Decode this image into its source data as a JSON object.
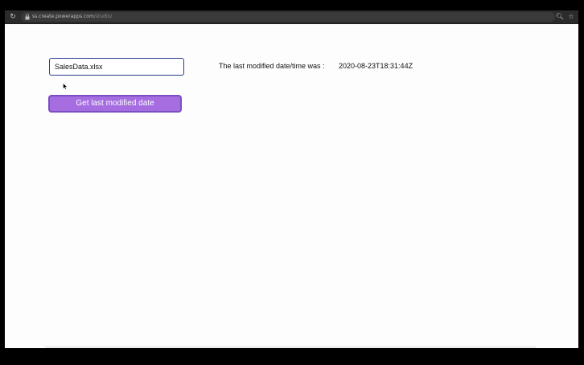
{
  "browser": {
    "url_host": "ss.create.powerapps.com",
    "url_path": "/studio/",
    "reload_icon": "reload-icon",
    "lock_icon": "lock-icon",
    "zoom_icon": "zoom-icon",
    "star_icon": "star-icon"
  },
  "app": {
    "file_input_value": "SalesData.xlsx",
    "button_label": "Get last modified date",
    "result_label": "The last modified date/time was :",
    "result_value": "2020-08-23T18:31:44Z",
    "button_color": "#a56ddf",
    "input_border_color": "#2b3b8f"
  }
}
